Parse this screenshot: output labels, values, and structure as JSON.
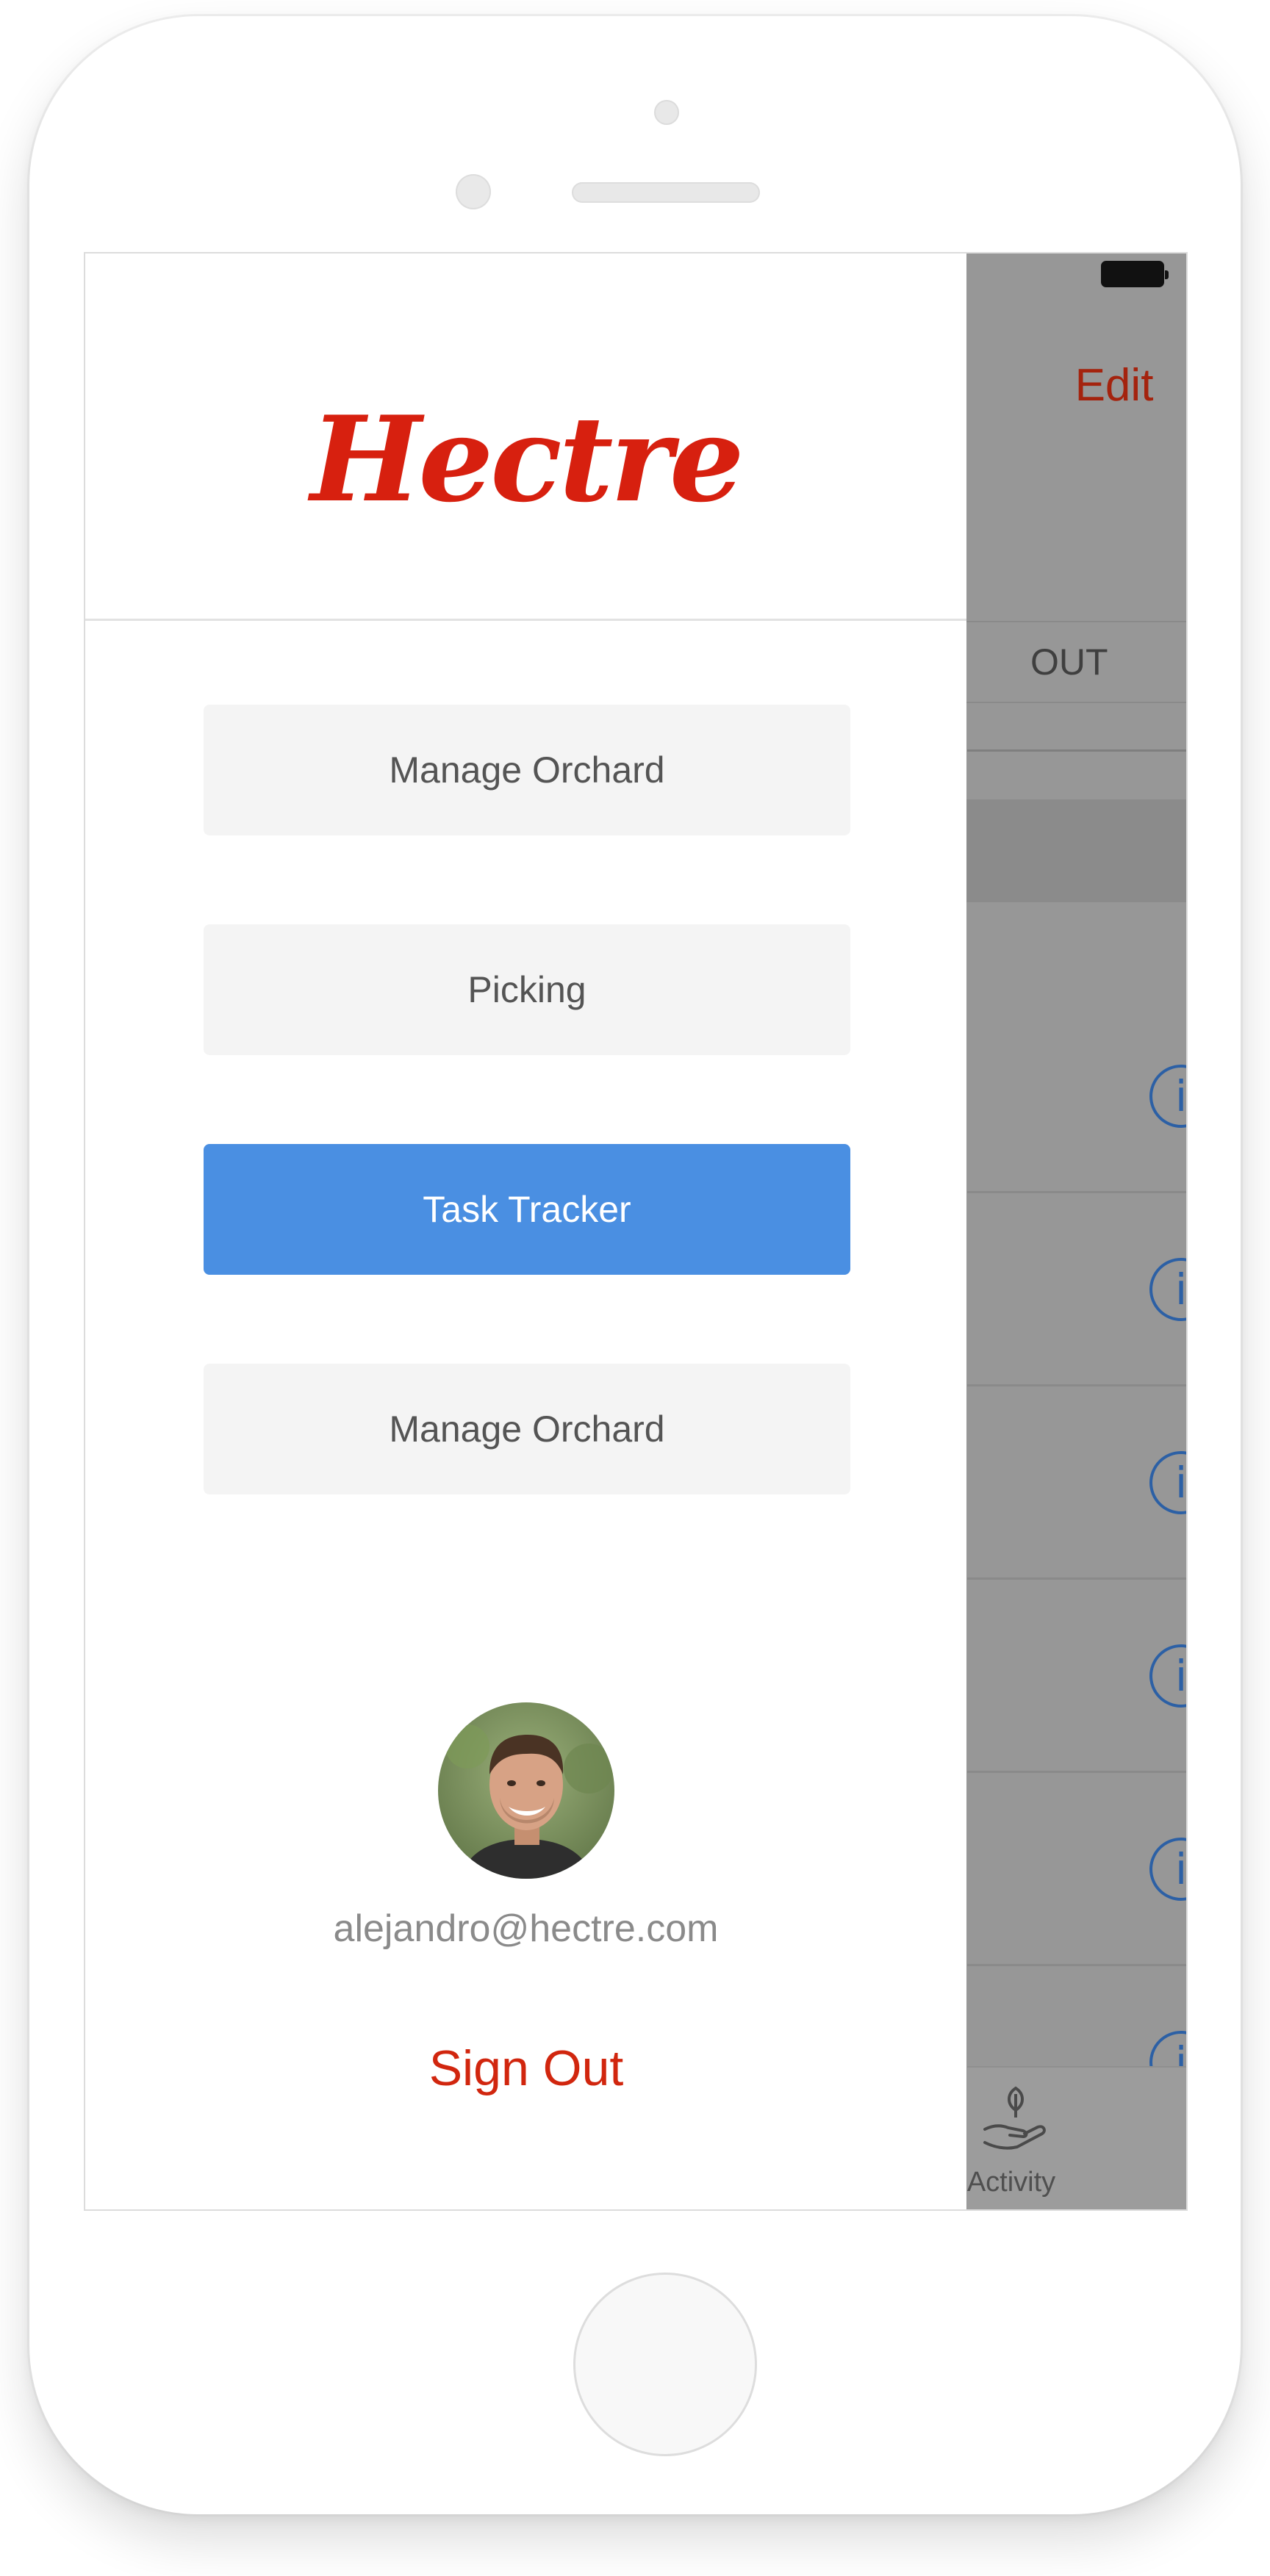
{
  "drawer": {
    "logo": "Hectre",
    "menu_items": [
      {
        "label": "Manage Orchard",
        "active": false
      },
      {
        "label": "Picking",
        "active": false
      },
      {
        "label": "Task Tracker",
        "active": true
      },
      {
        "label": "Manage Orchard",
        "active": false
      }
    ],
    "user": {
      "avatar_icon": "user-avatar-photo",
      "email": "alejandro@hectre.com"
    },
    "sign_out_label": "Sign Out"
  },
  "background_screen": {
    "edit_label": "Edit",
    "segment_label": "OUT",
    "row_icon": "info-icon",
    "row_count": 6,
    "tab_bar": {
      "activity_icon": "plant-in-hand-icon",
      "activity_label": "Activity"
    }
  },
  "colors": {
    "brand_red": "#d7200f",
    "active_blue": "#4a8fe2",
    "menu_button_gray": "#f4f4f4",
    "info_icon_blue": "#2c60a5",
    "overlay_gray": "#979797"
  }
}
